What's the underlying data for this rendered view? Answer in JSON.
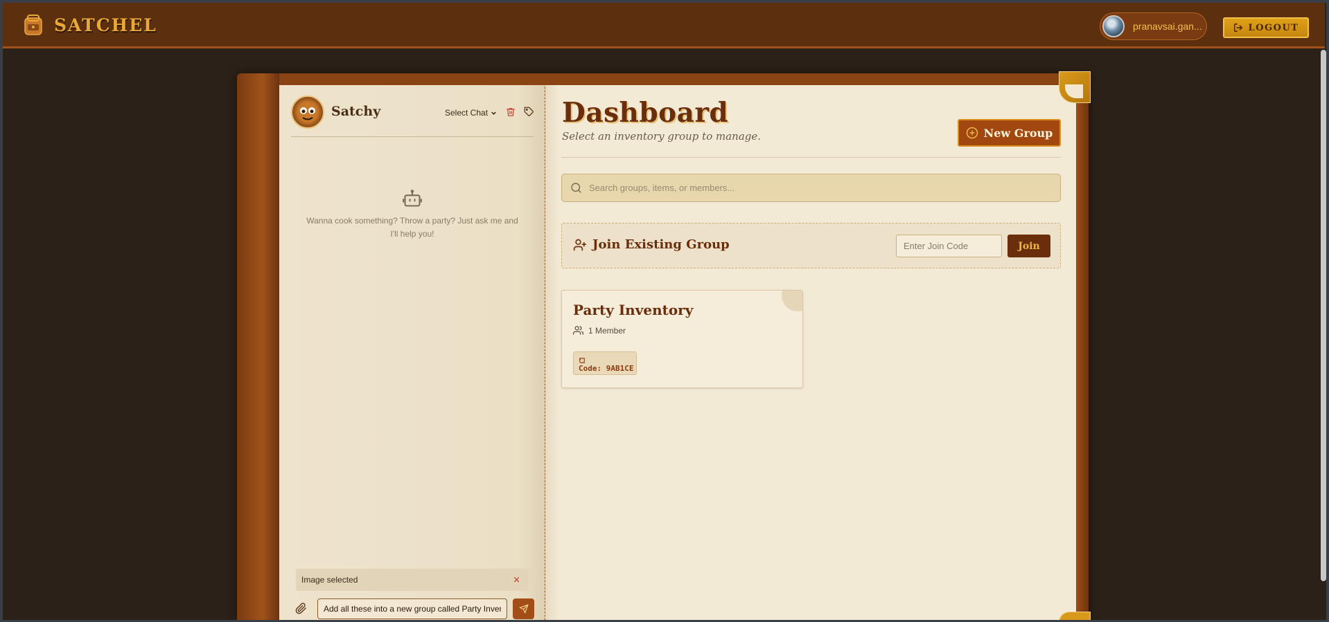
{
  "app": {
    "brand": "SATCHEL",
    "user_name": "pranavsai.gan...",
    "logout_label": "LOGOUT"
  },
  "chat": {
    "bot_name": "Satchy",
    "select_chat_label": "Select Chat",
    "empty_message": "Wanna cook something? Throw a party? Just ask me and I'll help you!",
    "attachment_label": "Image selected",
    "attachment_close": "×",
    "input_value": "Add all these into a new group called Party Inventory"
  },
  "dashboard": {
    "title": "Dashboard",
    "subtitle": "Select an inventory group to manage.",
    "new_group_label": "New Group",
    "search_placeholder": "Search groups, items, or members...",
    "join": {
      "title": "Join Existing Group",
      "input_placeholder": "Enter Join Code",
      "button_label": "Join"
    },
    "groups": [
      {
        "name": "Party Inventory",
        "members": "1 Member",
        "code": "Code: 9AB1CE"
      }
    ]
  },
  "colors": {
    "header_bg": "#5c2f0f",
    "brand_gold": "#e8a93a",
    "accent_brown": "#6a2e0c",
    "page_bg": "#f3ead6"
  },
  "icons": [
    "backpack-icon",
    "logout-icon",
    "trash-icon",
    "tag-icon",
    "bot-icon",
    "paperclip-icon",
    "send-icon",
    "plus-circle-icon",
    "search-icon",
    "user-plus-icon",
    "users-icon",
    "scroll-icon",
    "chevron-down-icon"
  ]
}
